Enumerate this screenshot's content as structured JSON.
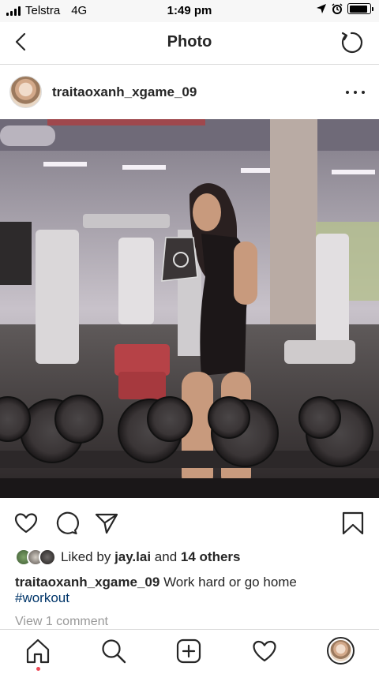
{
  "status_bar": {
    "carrier": "Telstra",
    "network": "4G",
    "time": "1:49 pm",
    "battery_level": 0.9
  },
  "nav": {
    "title": "Photo",
    "back_icon": "chevron-left-icon",
    "refresh_icon": "refresh-icon"
  },
  "post": {
    "username": "traitaoxanh_xgame_09",
    "more_icon": "more-horizontal-icon",
    "photo": "gym-mirror-selfie",
    "likes": {
      "prefix": "Liked by",
      "first_user": "jay.lai",
      "connector": "and",
      "others": "14 others"
    },
    "caption": {
      "username": "traitaoxanh_xgame_09",
      "text": "Work hard or go home",
      "hashtag": "#workout"
    },
    "view_comments": "View 1 comment"
  },
  "actions": [
    "heart-icon",
    "comment-icon",
    "share-icon",
    "bookmark-icon"
  ],
  "tab_bar": [
    "home-icon",
    "search-icon",
    "add-post-icon",
    "activity-heart-icon",
    "profile-avatar"
  ],
  "colors": {
    "text": "#262626",
    "hashtag": "#003569",
    "muted": "#999999",
    "notification_dot": "#ed4956"
  }
}
